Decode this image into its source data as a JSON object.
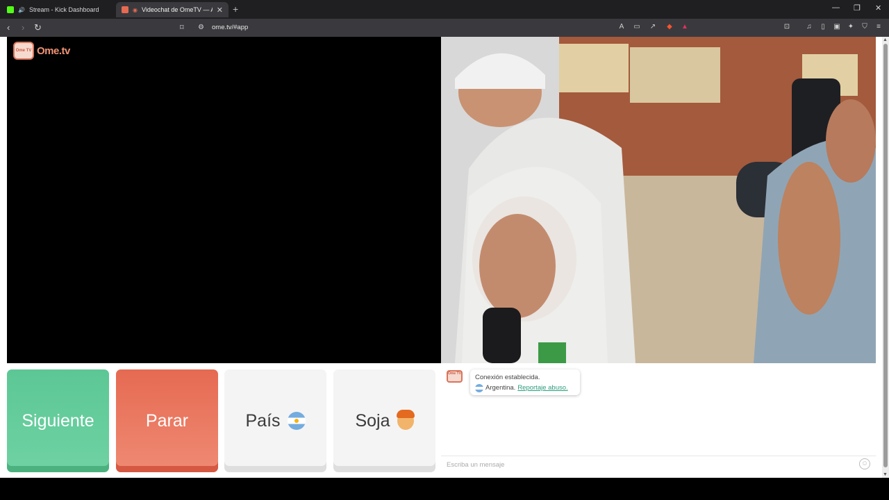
{
  "browser": {
    "tabs": [
      {
        "title": "Stream - Kick Dashboard",
        "favicon_color": "#53fc18"
      },
      {
        "title": "Videochat de OmeTV — Alte",
        "favicon_color": "#e66a52"
      }
    ],
    "url": "ome.tv/#app"
  },
  "site": {
    "logo_badge": "Ome TV",
    "logo_text": "Ome.tv"
  },
  "controls": {
    "next_label": "Siguiente",
    "stop_label": "Parar",
    "country_label": "País",
    "gender_label": "Soja"
  },
  "chat": {
    "messages": [
      {
        "line1": "Conexión establecida.",
        "country": "Argentina.",
        "report_link": "Reportaje abuso."
      }
    ],
    "input_placeholder": "Escriba un mensaje"
  },
  "colors": {
    "next": "#5cc795",
    "stop": "#e66a52",
    "link": "#2a9c7a",
    "brand": "#f19373"
  }
}
